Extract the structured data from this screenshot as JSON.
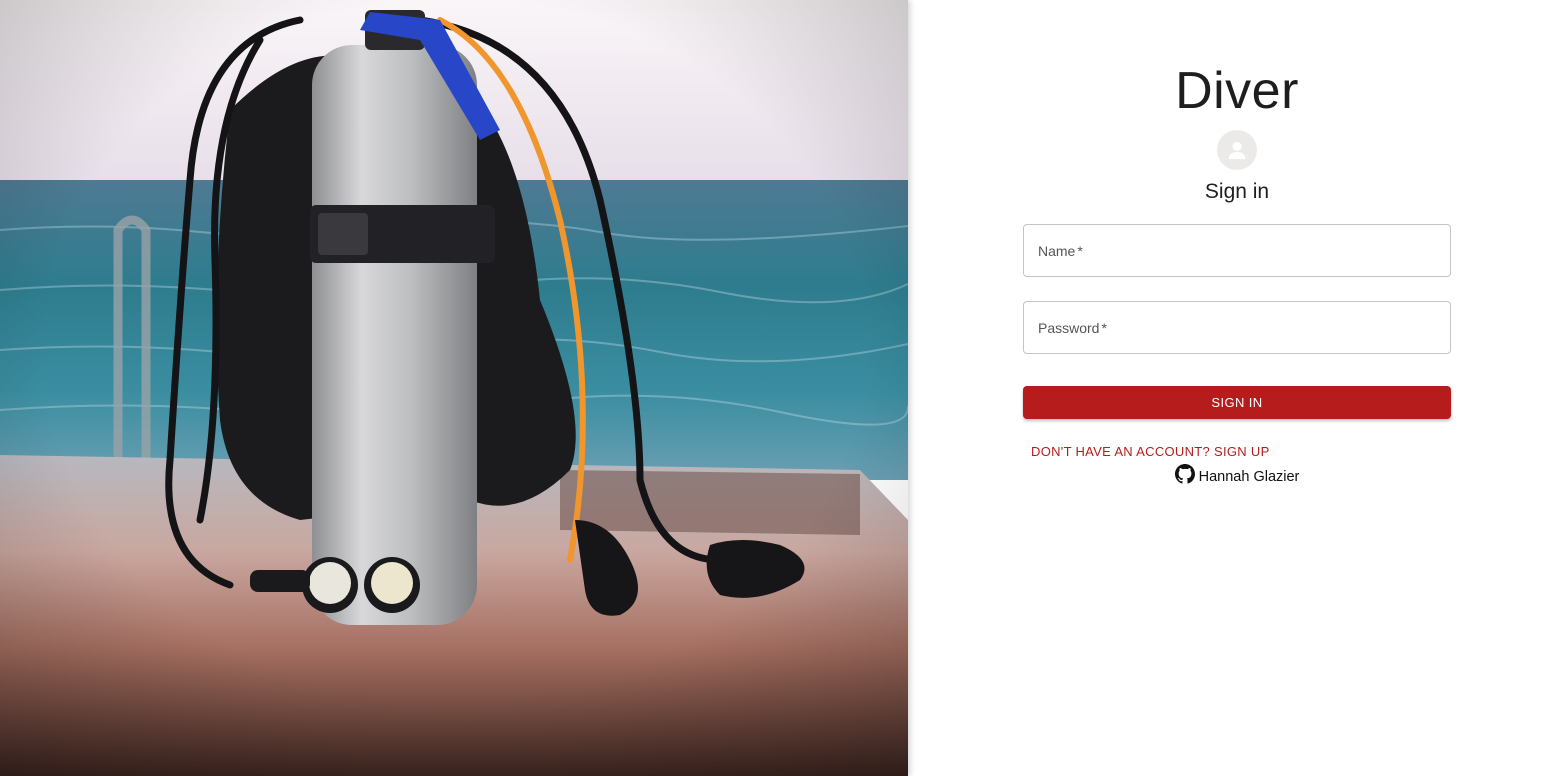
{
  "brand": {
    "title": "Diver"
  },
  "form": {
    "heading": "Sign in",
    "name_label": "Name",
    "password_label": "Password",
    "required_marker": "*",
    "name_value": "",
    "password_value": "",
    "submit_label": "SIGN IN",
    "signup_link": "DON'T HAVE AN ACCOUNT? SIGN UP"
  },
  "footer": {
    "author": "Hannah Glazier",
    "icon": "github-icon"
  },
  "icons": {
    "avatar": "account-circle-icon",
    "github": "github-icon"
  },
  "colors": {
    "accent": "#b71c1c",
    "avatar_bg": "#ece9e9",
    "border": "#c4c4c4"
  }
}
